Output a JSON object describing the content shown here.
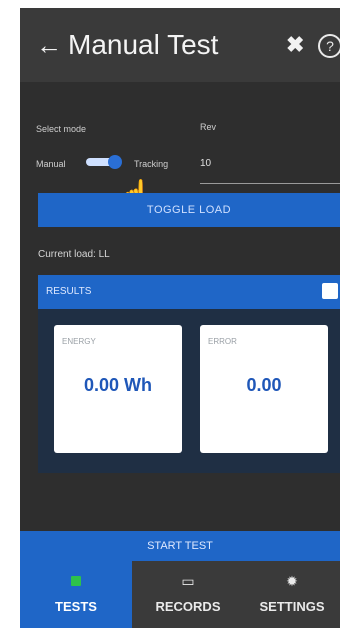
{
  "appbar": {
    "title": "Manual Test",
    "back_icon": "arrow-left-icon",
    "tools_icon": "wrench-cross-icon",
    "help_icon": "question-icon"
  },
  "mode": {
    "select_label": "Select mode",
    "manual_label": "Manual",
    "tracking_label": "Tracking",
    "rev_label": "Rev",
    "rev_value": "10"
  },
  "toggle_load_label": "TOGGLE LOAD",
  "current_load_text": "Current load: LL",
  "results": {
    "label": "RESULTS",
    "energy": {
      "label": "ENERGY",
      "value": "0.00 Wh"
    },
    "error": {
      "label": "ERROR",
      "value": "0.00"
    }
  },
  "start_test_label": "START TEST",
  "nav": {
    "tests": "TESTS",
    "records": "RECORDS",
    "settings": "SETTINGS"
  },
  "colors": {
    "accent": "#1f66c7",
    "appbar": "#3a3a3a",
    "background": "#2e2e2e"
  }
}
